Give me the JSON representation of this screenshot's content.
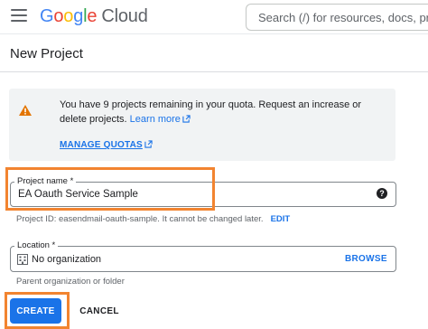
{
  "header": {
    "logo_google": [
      "G",
      "o",
      "o",
      "g",
      "l",
      "e"
    ],
    "logo_cloud": "Cloud",
    "search_placeholder": "Search (/) for resources, docs, products"
  },
  "page": {
    "title": "New Project"
  },
  "quota_notice": {
    "icon": "warning-icon",
    "text": "You have 9 projects remaining in your quota. Request an increase or delete projects.",
    "learn_more": "Learn more",
    "manage_quotas": "MANAGE QUOTAS"
  },
  "project_name": {
    "label": "Project name *",
    "value": "EA Oauth Service Sample",
    "help_icon": "?"
  },
  "project_id": {
    "text": "Project ID: easendmail-oauth-sample. It cannot be changed later.",
    "edit_label": "EDIT"
  },
  "location": {
    "label": "Location *",
    "icon": "building-icon",
    "value": "No organization",
    "browse_label": "BROWSE",
    "hint": "Parent organization or folder"
  },
  "actions": {
    "create_label": "CREATE",
    "cancel_label": "CANCEL"
  },
  "colors": {
    "accent": "#1a73e8",
    "highlight": "#f28430",
    "warning": "#e37400"
  }
}
